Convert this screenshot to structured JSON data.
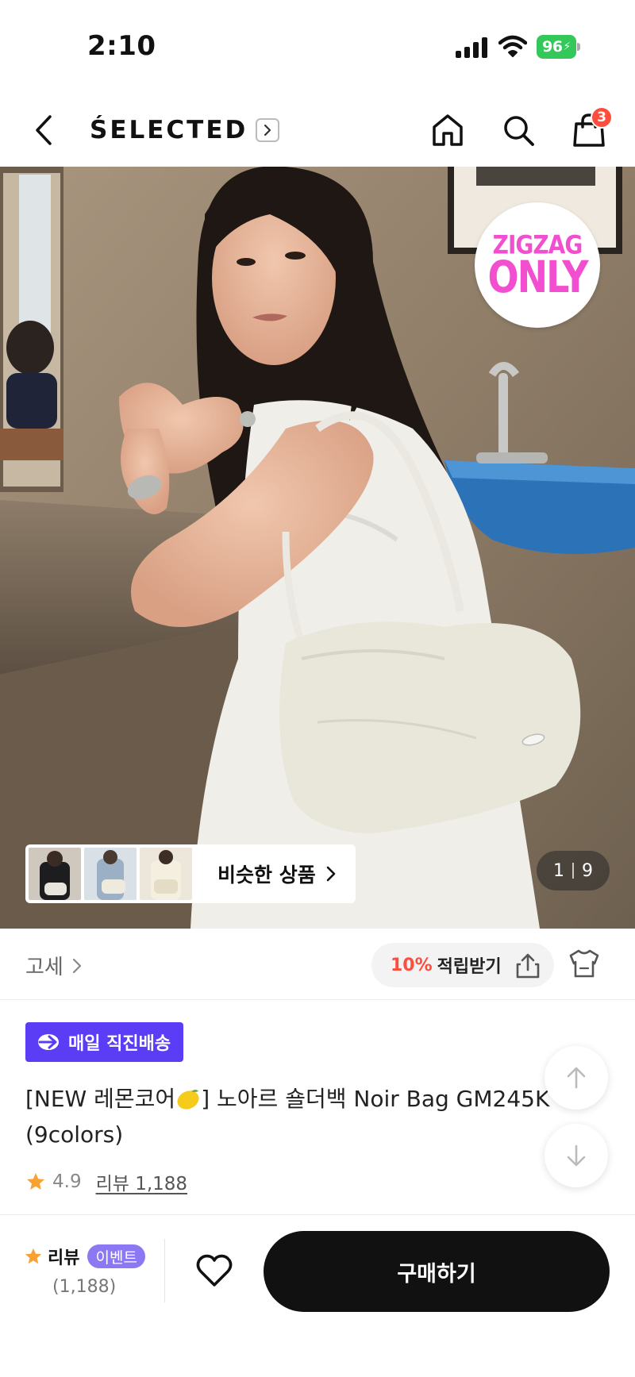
{
  "status": {
    "time": "2:10",
    "battery": "96"
  },
  "header": {
    "brand": "ŚELECTED",
    "cart_count": "3"
  },
  "hero": {
    "badge_line1": "ZIGZAG",
    "badge_line2": "ONLY",
    "similar_label": "비슷한 상품",
    "page_current": "1",
    "page_total": "9"
  },
  "info": {
    "store_label": "고세",
    "points_percent": "10%",
    "points_label": "적립받기"
  },
  "product": {
    "delivery_badge": "매일 직진배송",
    "title_part1": "[NEW 레몬코어",
    "title_part2": "] 노아르 숄더백 Noir Bag GM245K",
    "title_line2": "(9colors)",
    "rating": "4.9",
    "review_link": "리뷰 1,188"
  },
  "bottom": {
    "review_label": "리뷰",
    "event_badge": "이벤트",
    "review_count": "(1,188)",
    "buy_label": "구매하기"
  },
  "colors": {
    "accent_purple": "#5b3df5",
    "badge_pink": "#f24fd0",
    "points_red": "#ff4d3d",
    "star_orange": "#f7a233",
    "battery_green": "#34c759"
  },
  "icons": [
    "back-icon",
    "chevron-right-icon",
    "home-icon",
    "search-icon",
    "shopping-bag-icon",
    "share-icon",
    "fit-body-icon",
    "lightning-delivery-icon",
    "star-icon",
    "arrow-up-icon",
    "arrow-down-icon",
    "heart-icon"
  ]
}
